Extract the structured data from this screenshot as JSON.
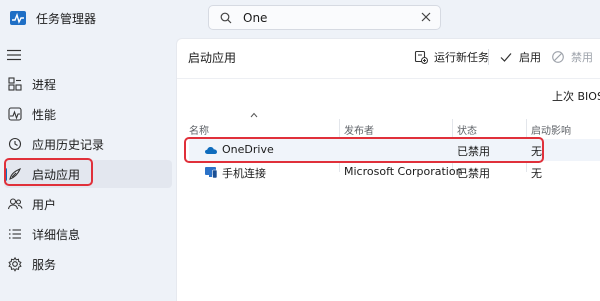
{
  "app": {
    "title": "任务管理器"
  },
  "search": {
    "value": "One"
  },
  "sidebar": {
    "items": [
      {
        "label": "进程",
        "icon": "processes-icon"
      },
      {
        "label": "性能",
        "icon": "performance-icon"
      },
      {
        "label": "应用历史记录",
        "icon": "app-history-icon"
      },
      {
        "label": "启动应用",
        "icon": "startup-apps-icon",
        "active": true
      },
      {
        "label": "用户",
        "icon": "users-icon"
      },
      {
        "label": "详细信息",
        "icon": "details-icon"
      },
      {
        "label": "服务",
        "icon": "services-icon"
      }
    ]
  },
  "main": {
    "page_title": "启动应用",
    "toolbar": {
      "new_task": "运行新任务",
      "enable": "启用",
      "disable": "禁用"
    },
    "bios_time_label": "上次 BIOS 所",
    "table": {
      "columns": [
        "名称",
        "发布者",
        "状态",
        "启动影响"
      ],
      "rows": [
        {
          "name": "OneDrive",
          "publisher": "",
          "status": "已禁用",
          "impact": "无",
          "icon": "onedrive-icon",
          "selected": true
        },
        {
          "name": "手机连接",
          "publisher": "Microsoft Corporation",
          "status": "已禁用",
          "impact": "无",
          "icon": "phone-link-icon"
        }
      ]
    }
  },
  "colors": {
    "highlight": "#e0303a",
    "accent": "#0f6cbd",
    "background": "#eef2f8",
    "panel": "#ffffff"
  }
}
